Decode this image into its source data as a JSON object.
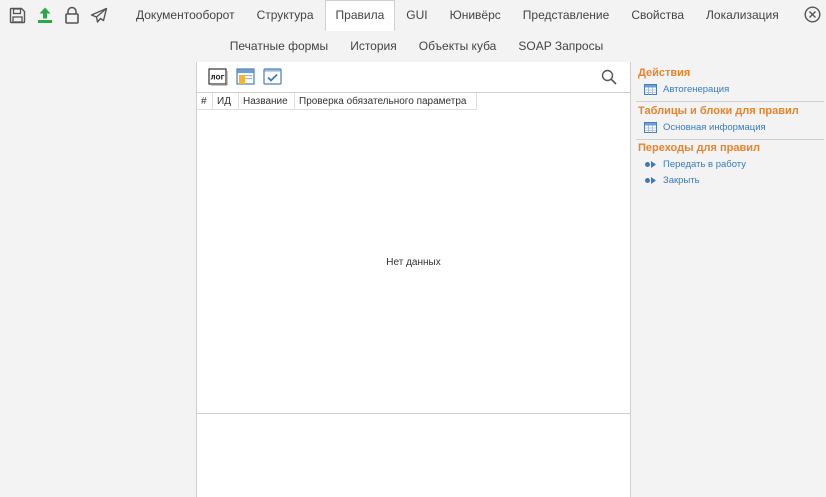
{
  "toolbar": {
    "icons": [
      "save-icon",
      "upload-icon",
      "lock-icon",
      "send-icon"
    ]
  },
  "tabs": [
    {
      "label": "Документооборот",
      "active": false
    },
    {
      "label": "Структура",
      "active": false
    },
    {
      "label": "Правила",
      "active": true
    },
    {
      "label": "GUI",
      "active": false
    },
    {
      "label": "Юнивёрс",
      "active": false
    },
    {
      "label": "Представление",
      "active": false
    },
    {
      "label": "Свойства",
      "active": false
    },
    {
      "label": "Локализация",
      "active": false
    }
  ],
  "subtabs": [
    {
      "label": "Печатные формы"
    },
    {
      "label": "История"
    },
    {
      "label": "Объекты куба"
    },
    {
      "label": "SOAP Запросы"
    }
  ],
  "center": {
    "toolbar_icons": [
      "log-icon",
      "table-icon",
      "check-icon"
    ],
    "log_label": "ЛОГ",
    "columns": [
      "#",
      "ИД",
      "Название",
      "Проверка обязательного параметра"
    ],
    "empty_text": "Нет данных"
  },
  "sidebar": {
    "sections": [
      {
        "title": "Действия",
        "links": [
          {
            "label": "Автогенерация",
            "icon": "grid-icon"
          }
        ]
      },
      {
        "title": "Таблицы и блоки для правил",
        "links": [
          {
            "label": "Основная информация",
            "icon": "grid-icon"
          }
        ]
      },
      {
        "title": "Переходы для правил",
        "links": [
          {
            "label": "Передать в работу",
            "icon": "arrow-icon"
          },
          {
            "label": "Закрыть",
            "icon": "arrow-icon"
          }
        ]
      }
    ]
  },
  "colors": {
    "accent_orange": "#e8842c",
    "link_blue": "#3a7bbf",
    "upload_green": "#2aa84a",
    "panel_bg": "#f3f3f3"
  }
}
